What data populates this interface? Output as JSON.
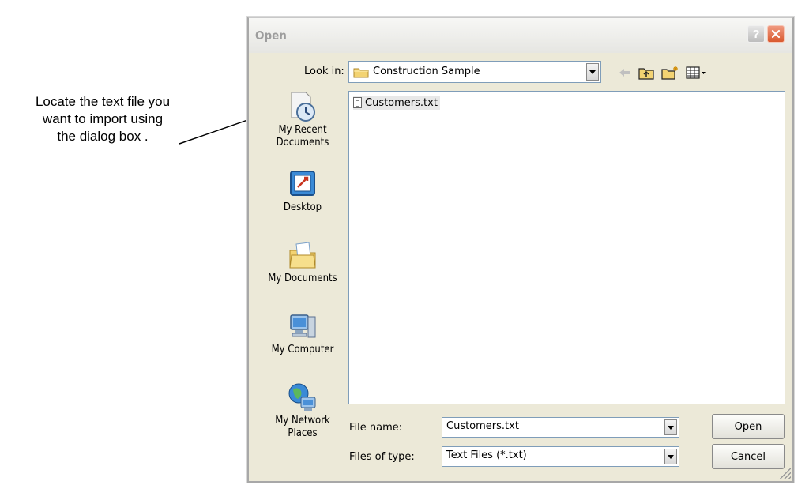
{
  "annotation": {
    "lines": [
      "Locate the text file you",
      "want to import using",
      "the dialog box ."
    ]
  },
  "dialog": {
    "title": "Open",
    "help_label": "?",
    "close_label": "×",
    "look_in_label": "Look in:",
    "look_in_value": "Construction Sample",
    "places": [
      {
        "label_1": "My Recent",
        "label_2": "Documents",
        "icon": "recent-documents-icon"
      },
      {
        "label_1": "Desktop",
        "icon": "desktop-icon"
      },
      {
        "label_1": "My Documents",
        "icon": "my-documents-icon"
      },
      {
        "label_1": "My Computer",
        "icon": "my-computer-icon"
      },
      {
        "label_1": "My Network",
        "label_2": "Places",
        "icon": "network-places-icon"
      }
    ],
    "files": [
      {
        "name": "Customers.txt",
        "icon": "text-file-icon"
      }
    ],
    "file_name_label": "File name:",
    "file_name_value": "Customers.txt",
    "file_type_label": "Files of type:",
    "file_type_value": "Text Files (*.txt)",
    "open_label": "Open",
    "cancel_label": "Cancel"
  },
  "colors": {
    "dialog_bg": "#ece9d8",
    "input_border": "#7f9db9",
    "close_button": "#d9592f",
    "folder_yellow": "#f3d372"
  }
}
